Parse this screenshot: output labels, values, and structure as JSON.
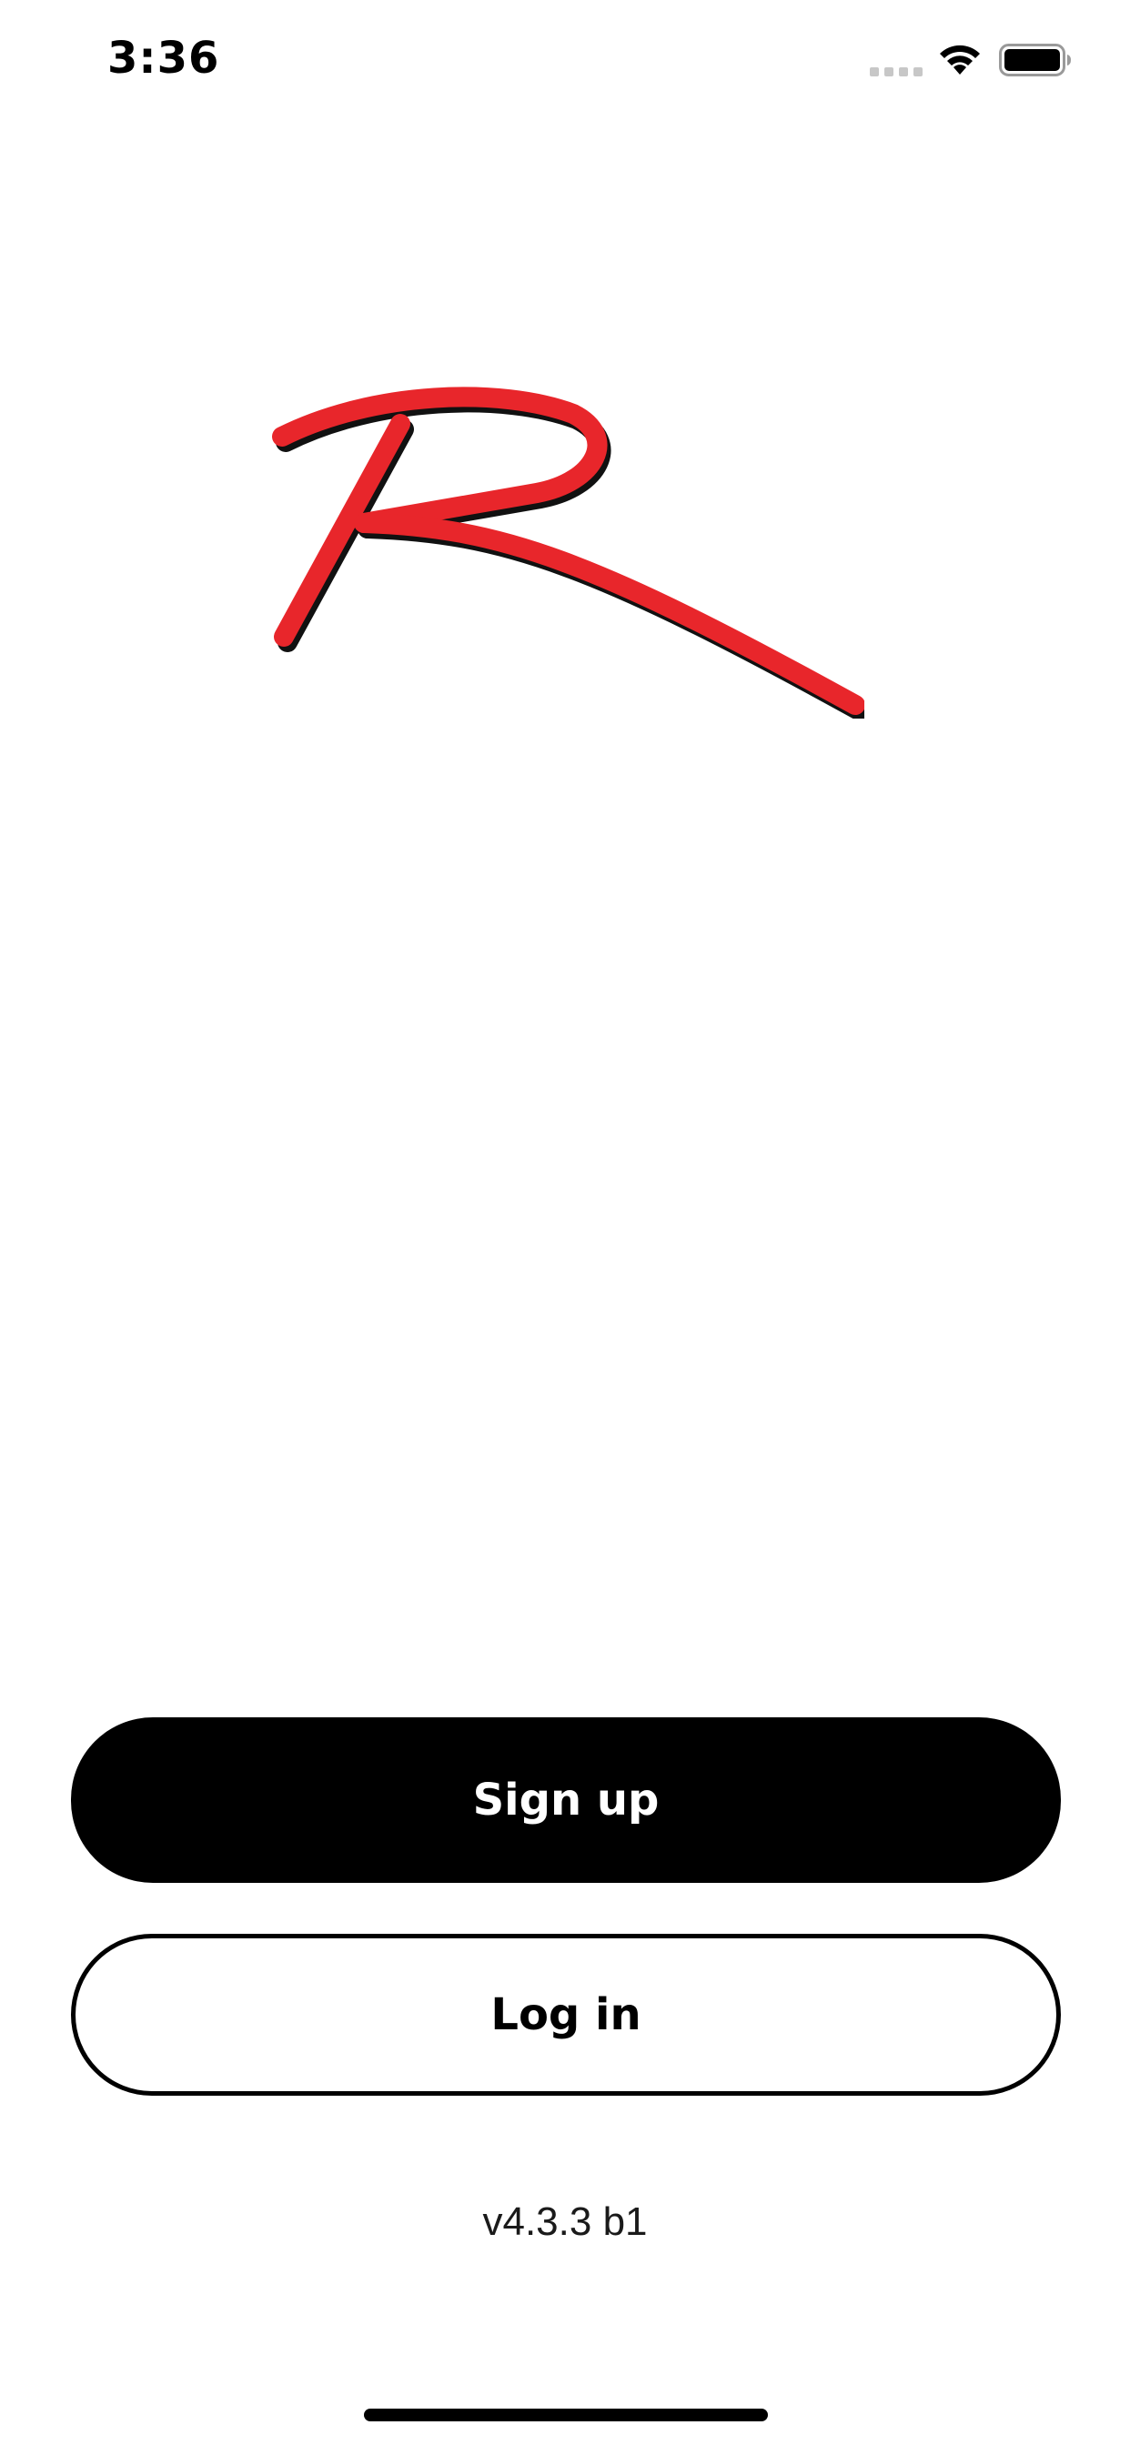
{
  "status_bar": {
    "time": "3:36"
  },
  "logo": {
    "icon": "brand-r-logo",
    "colors": {
      "fill": "#e8262b",
      "shadow": "#111111"
    }
  },
  "auth": {
    "signup_label": "Sign up",
    "login_label": "Log in"
  },
  "footer": {
    "version": "v4.3.3 b1"
  },
  "colors": {
    "primary_button_bg": "#000000",
    "primary_button_text": "#ffffff",
    "secondary_button_bg": "#ffffff",
    "secondary_button_border": "#000000"
  }
}
